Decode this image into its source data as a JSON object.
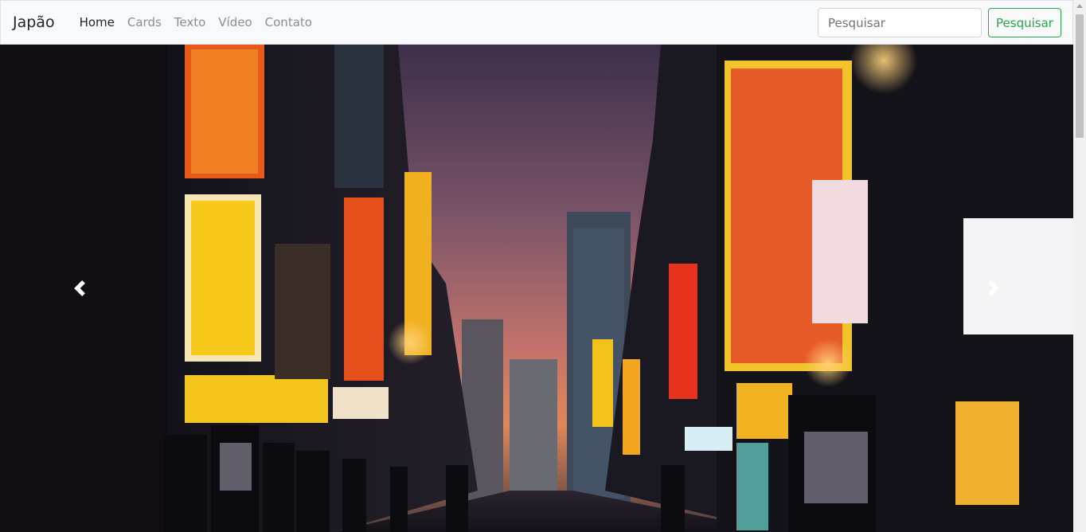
{
  "navbar": {
    "brand": "Japão",
    "links": [
      {
        "label": "Home",
        "active": true
      },
      {
        "label": "Cards",
        "active": false
      },
      {
        "label": "Texto",
        "active": false
      },
      {
        "label": "Vídeo",
        "active": false
      },
      {
        "label": "Contato",
        "active": false
      }
    ],
    "search": {
      "placeholder": "Pesquisar",
      "button_label": "Pesquisar"
    }
  },
  "carousel": {
    "prev_icon": "chevron-left-icon",
    "next_icon": "chevron-right-icon"
  },
  "colors": {
    "navbar_bg": "#f8f9fa",
    "brand_text": "#212529",
    "link_muted": "#8c8f92",
    "button_green": "#28a745",
    "sky_top": "#3c2f4a",
    "sky_horizon": "#e0875a"
  }
}
